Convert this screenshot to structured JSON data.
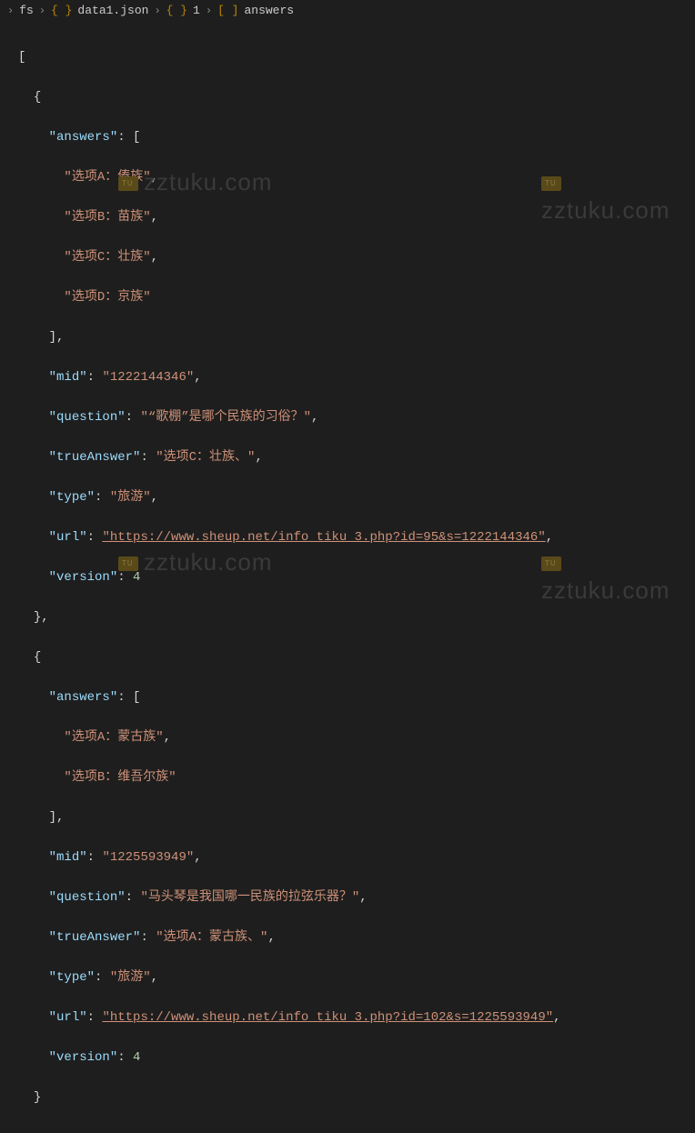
{
  "breadcrumb": {
    "seg0": "fs",
    "seg1": "data1.json",
    "seg2": "1",
    "seg3": "answers"
  },
  "code": {
    "obj1": {
      "key_answers": "\"answers\"",
      "ans0": "\"选项A：傣族\"",
      "ans1": "\"选项B：苗族\"",
      "ans2": "\"选项C：壮族\"",
      "ans3": "\"选项D：京族\"",
      "key_mid": "\"mid\"",
      "val_mid": "\"1222144346\"",
      "key_question": "\"question\"",
      "val_question": "\"“歌棚”是哪个民族的习俗？\"",
      "key_trueAnswer": "\"trueAnswer\"",
      "val_trueAnswer": "\"选项C：壮族、\"",
      "key_type": "\"type\"",
      "val_type": "\"旅游\"",
      "key_url": "\"url\"",
      "val_url": "\"https://www.sheup.net/info_tiku_3.php?id=95&s=1222144346\"",
      "key_version": "\"version\"",
      "val_version": "4"
    },
    "obj2": {
      "key_answers": "\"answers\"",
      "ans0": "\"选项A：蒙古族\"",
      "ans1": "\"选项B：维吾尔族\"",
      "key_mid": "\"mid\"",
      "val_mid": "\"1225593949\"",
      "key_question": "\"question\"",
      "val_question": "\"马头琴是我国哪一民族的拉弦乐器？\"",
      "key_trueAnswer": "\"trueAnswer\"",
      "val_trueAnswer": "\"选项A：蒙古族、\"",
      "key_type": "\"type\"",
      "val_type": "\"旅游\"",
      "key_url": "\"url\"",
      "val_url": "\"https://www.sheup.net/info_tiku_3.php?id=102&s=1225593949\"",
      "key_version": "\"version\"",
      "val_version": "4"
    }
  },
  "watermark": "zztuku.com"
}
